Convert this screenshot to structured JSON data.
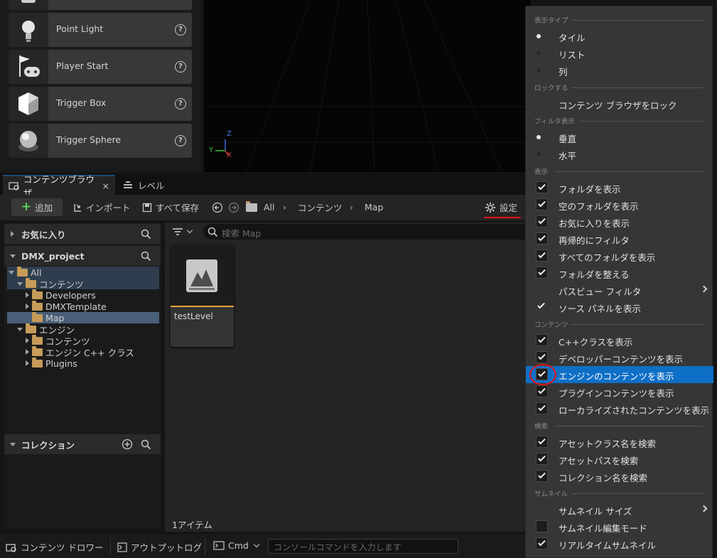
{
  "place_actors": [
    {
      "label": "Point Light",
      "icon": "bulb-icon"
    },
    {
      "label": "Player Start",
      "icon": "flag-icon"
    },
    {
      "label": "Trigger Box",
      "icon": "cube-icon"
    },
    {
      "label": "Trigger Sphere",
      "icon": "sphere-icon"
    }
  ],
  "viewport": {
    "axis_z": "Z",
    "axis_y": "Y",
    "axis_x": "X"
  },
  "tabs": {
    "content_browser": "コンテンツブラウザ",
    "close": "×",
    "level": "レベル"
  },
  "toolbar": {
    "add": "追加",
    "import": "インポート",
    "save_all": "すべて保存",
    "breadcrumb": [
      "All",
      "コンテンツ",
      "Map"
    ],
    "settings": "設定"
  },
  "sources": {
    "favorites": "お気に入り",
    "project": "DMX_project",
    "tree": [
      "All",
      "コンテンツ",
      "Developers",
      "DMXTemplate",
      "Map",
      "エンジン",
      "コンテンツ",
      "エンジン C++ クラス",
      "Plugins"
    ],
    "collections": "コレクション"
  },
  "assets": {
    "search_placeholder": "検索 Map",
    "items": [
      {
        "name": "testLevel"
      }
    ],
    "count": "1アイテム"
  },
  "status": {
    "drawer": "コンテンツ ドロワー",
    "output_log": "アウトプットログ",
    "cmd": "Cmd",
    "console_placeholder": "コンソールコマンドを入力します"
  },
  "menu": {
    "sec_view_type": "表示タイプ",
    "view_tile": "タイル",
    "view_list": "リスト",
    "view_column": "列",
    "sec_lock": "ロックする",
    "lock_browser": "コンテンツ ブラウザをロック",
    "sec_filter_display": "フィルタ表示",
    "filter_vertical": "垂直",
    "filter_horizontal": "水平",
    "sec_display": "表示",
    "show_folders": "フォルダを表示",
    "show_empty_folders": "空のフォルダを表示",
    "show_favorites": "お気に入りを表示",
    "filter_recursive": "再帰的にフィルタ",
    "show_all_folders": "すべてのフォルダを表示",
    "organize_folders": "フォルダを整える",
    "path_view_filter": "パスビュー フィルタ",
    "show_source_panel": "ソース パネルを表示",
    "sec_content": "コンテンツ",
    "show_cpp": "C++クラスを表示",
    "show_developer": "デベロッパーコンテンツを表示",
    "show_engine": "エンジンのコンテンツを表示",
    "show_plugin": "プラグインコンテンツを表示",
    "show_localized": "ローカライズされたコンテンツを表示",
    "sec_search": "検索",
    "search_class": "アセットクラス名を検索",
    "search_path": "アセットパスを検索",
    "search_collection": "コレクション名を検索",
    "sec_thumbnail": "サムネイル",
    "thumb_size": "サムネイル サイズ",
    "thumb_edit": "サムネイル編集モード",
    "realtime_thumb": "リアルタイムサムネイル"
  },
  "colors": {
    "highlight": "#0e6fc6",
    "annotation": "#e01414",
    "folder": "#c69c58",
    "accent": "#e8a33c"
  }
}
